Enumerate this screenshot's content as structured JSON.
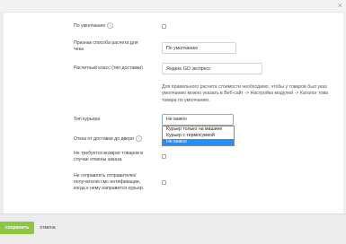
{
  "window": {
    "close_icon": "close-icon"
  },
  "form": {
    "default_label_top": "По умолчанию",
    "payment_sign_label_1": "Признак способа расчета для",
    "payment_sign_label_2": "чека",
    "payment_sign_value": "По умолчанию",
    "tax_class_label": "Расчетный класс (тип доставки)",
    "tax_class_value": "Яндекс GO экспресс",
    "note_lines": [
      "Для правильного расчета стоимости необходимо, чтобы у товаров был указ",
      "умолчанию можно указать в Веб-сайт -> Настройка модулей -> Каталог това",
      "товара по умолчанию."
    ],
    "courier_type_label": "Тип курьера",
    "courier_type_value": "Не важно",
    "courier_type_options": [
      "Курьер только на машине",
      "Курьер с термосумкой",
      "Не важно"
    ],
    "refuse_door_label": "Отказ от доставки до двери",
    "no_return_label_1": "Не требуется возврат товаров в",
    "no_return_label_2": "случае отмены заказа",
    "no_sms_label_1": "Не отправлять отправителю/",
    "no_sms_label_2": "получателю смс-нотификации,",
    "no_sms_label_3": "когда к нему направится курьер."
  },
  "footer": {
    "save_label": "сохранить",
    "cancel_label": "отмена"
  },
  "colors": {
    "save_button": "#8dc63f",
    "selected_option": "#1e90ff",
    "select_border": "#7fb1d9"
  }
}
